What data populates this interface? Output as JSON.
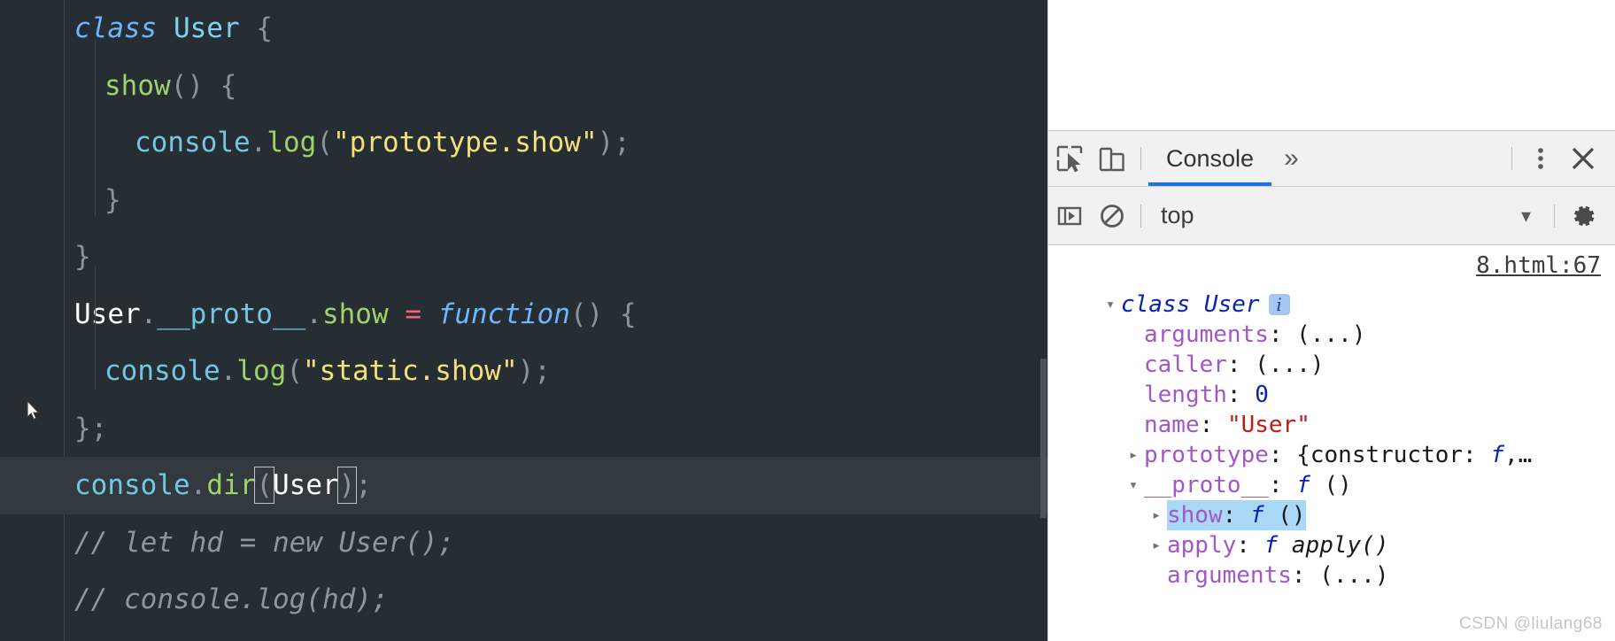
{
  "editor": {
    "theme_bg": "#272e33",
    "active_line_bg": "#323a40",
    "lines": [
      {
        "id": 1,
        "tokens": [
          {
            "t": "class ",
            "c": "tk-kw"
          },
          {
            "t": "User",
            "c": "tk-cls"
          },
          {
            "t": " {",
            "c": "tk-punc"
          }
        ]
      },
      {
        "id": 2,
        "indent": 1,
        "tokens": [
          {
            "t": "show",
            "c": "tk-fn"
          },
          {
            "t": "() {",
            "c": "tk-punc"
          }
        ]
      },
      {
        "id": 3,
        "indent": 2,
        "tokens": [
          {
            "t": "console",
            "c": "tk-obj"
          },
          {
            "t": ".",
            "c": "tk-punc"
          },
          {
            "t": "log",
            "c": "tk-fn"
          },
          {
            "t": "(",
            "c": "tk-punc"
          },
          {
            "t": "\"prototype.show\"",
            "c": "tk-str"
          },
          {
            "t": ");",
            "c": "tk-punc"
          }
        ]
      },
      {
        "id": 4,
        "indent": 1,
        "tokens": [
          {
            "t": "}",
            "c": "tk-punc"
          }
        ]
      },
      {
        "id": 5,
        "tokens": [
          {
            "t": "}",
            "c": "tk-punc"
          }
        ]
      },
      {
        "id": 6,
        "tokens": [
          {
            "t": "User",
            "c": "tk-white"
          },
          {
            "t": ".",
            "c": "tk-punc"
          },
          {
            "t": "__proto__",
            "c": "tk-prop"
          },
          {
            "t": ".",
            "c": "tk-punc"
          },
          {
            "t": "show",
            "c": "tk-fn"
          },
          {
            "t": " ",
            "c": "tk-punc"
          },
          {
            "t": "=",
            "c": "tk-op"
          },
          {
            "t": " ",
            "c": "tk-punc"
          },
          {
            "t": "function",
            "c": "tk-kw"
          },
          {
            "t": "() {",
            "c": "tk-punc"
          }
        ]
      },
      {
        "id": 7,
        "indent": 1,
        "tokens": [
          {
            "t": "console",
            "c": "tk-obj"
          },
          {
            "t": ".",
            "c": "tk-punc"
          },
          {
            "t": "log",
            "c": "tk-fn"
          },
          {
            "t": "(",
            "c": "tk-punc"
          },
          {
            "t": "\"static.show\"",
            "c": "tk-str"
          },
          {
            "t": ");",
            "c": "tk-punc"
          }
        ]
      },
      {
        "id": 8,
        "tokens": [
          {
            "t": "};",
            "c": "tk-punc"
          }
        ]
      },
      {
        "id": 9,
        "active": true,
        "tokens": [
          {
            "t": "console",
            "c": "tk-obj"
          },
          {
            "t": ".",
            "c": "tk-punc"
          },
          {
            "t": "dir",
            "c": "tk-fn"
          },
          {
            "t": "(",
            "c": "tk-punc",
            "box": true
          },
          {
            "t": "User",
            "c": "tk-white"
          },
          {
            "t": ")",
            "c": "tk-punc",
            "box": true
          },
          {
            "t": ";",
            "c": "tk-punc"
          }
        ]
      },
      {
        "id": 10,
        "tokens": [
          {
            "t": "// let hd = new User();",
            "c": "tk-comment"
          }
        ]
      },
      {
        "id": 11,
        "tokens": [
          {
            "t": "// console.log(hd);",
            "c": "tk-comment"
          }
        ]
      }
    ]
  },
  "devtools": {
    "toolbar": {
      "inspect_icon_title": "inspect-element",
      "device_icon_title": "device-toolbar",
      "tabs": [
        {
          "label": "Console",
          "selected": true
        }
      ],
      "more_tabs_label": "»",
      "kebab_label": "⋮",
      "close_label": "✕"
    },
    "filterbar": {
      "sidebar_toggle_title": "console-sidebar",
      "clear_title": "clear-console",
      "context": "top",
      "caret": "▾",
      "settings_title": "settings"
    },
    "console": {
      "source_link": "8.html:67",
      "entries": [
        {
          "indent": 0,
          "disclosure": "▾",
          "segments": [
            {
              "t": "class User",
              "c": "c-blue-it"
            }
          ],
          "badge": "i"
        },
        {
          "indent": 1,
          "disclosure": "",
          "segments": [
            {
              "t": "arguments",
              "c": "c-prop"
            },
            {
              "t": ": ",
              "c": "c-punc"
            },
            {
              "t": "(...)",
              "c": "c-dim"
            }
          ]
        },
        {
          "indent": 1,
          "disclosure": "",
          "segments": [
            {
              "t": "caller",
              "c": "c-prop"
            },
            {
              "t": ": ",
              "c": "c-punc"
            },
            {
              "t": "(...)",
              "c": "c-dim"
            }
          ]
        },
        {
          "indent": 1,
          "disclosure": "",
          "segments": [
            {
              "t": "length",
              "c": "c-prop"
            },
            {
              "t": ": ",
              "c": "c-punc"
            },
            {
              "t": "0",
              "c": "c-num"
            }
          ]
        },
        {
          "indent": 1,
          "disclosure": "",
          "segments": [
            {
              "t": "name",
              "c": "c-prop"
            },
            {
              "t": ": ",
              "c": "c-punc"
            },
            {
              "t": "\"User\"",
              "c": "c-str"
            }
          ]
        },
        {
          "indent": 1,
          "disclosure": "▸",
          "segments": [
            {
              "t": "prototype",
              "c": "c-prop"
            },
            {
              "t": ": ",
              "c": "c-punc"
            },
            {
              "t": "{constructor: ",
              "c": "c-dim"
            },
            {
              "t": "f",
              "c": "c-fn"
            },
            {
              "t": ",…",
              "c": "c-dim"
            }
          ]
        },
        {
          "indent": 1,
          "disclosure": "▾",
          "segments": [
            {
              "t": "__proto__",
              "c": "c-prop"
            },
            {
              "t": ": ",
              "c": "c-punc"
            },
            {
              "t": "f",
              "c": "c-fn"
            },
            {
              "t": " ()",
              "c": "c-dim"
            }
          ]
        },
        {
          "indent": 2,
          "disclosure": "▸",
          "highlight": true,
          "segments": [
            {
              "t": "show",
              "c": "c-prop"
            },
            {
              "t": ": ",
              "c": "c-punc"
            },
            {
              "t": "f",
              "c": "c-fn"
            },
            {
              "t": " ()",
              "c": "c-dim"
            }
          ]
        },
        {
          "indent": 2,
          "disclosure": "▸",
          "segments": [
            {
              "t": "apply",
              "c": "c-prop"
            },
            {
              "t": ": ",
              "c": "c-punc"
            },
            {
              "t": "f",
              "c": "c-fn"
            },
            {
              "t": " apply()",
              "c": "c-black-it"
            }
          ]
        },
        {
          "indent": 2,
          "disclosure": "",
          "segments": [
            {
              "t": "arguments",
              "c": "c-prop"
            },
            {
              "t": ": ",
              "c": "c-punc"
            },
            {
              "t": "(...)",
              "c": "c-dim"
            }
          ]
        }
      ]
    }
  },
  "watermark": "CSDN @liulang68"
}
